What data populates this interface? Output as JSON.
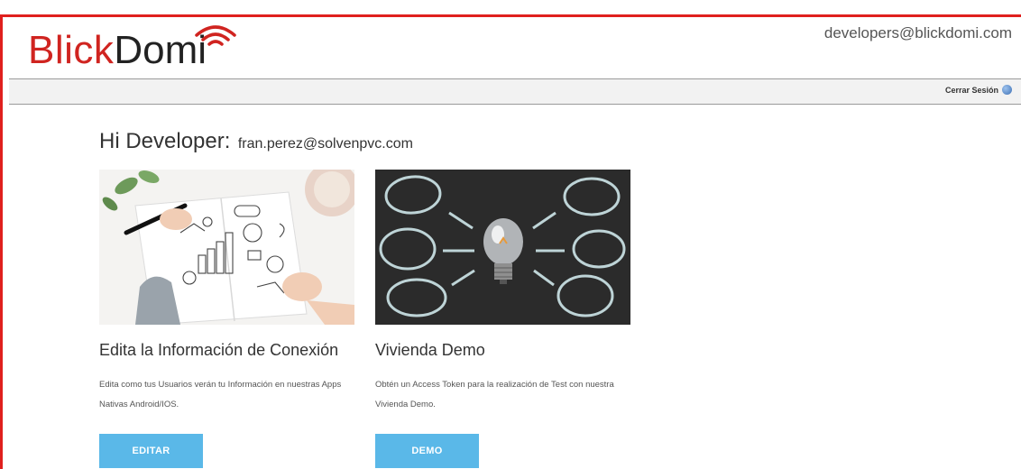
{
  "brand": {
    "logo_primary": "Blick",
    "logo_secondary": "Domi",
    "color": "#d02420"
  },
  "header": {
    "user_email": "developers@blickdomi.com"
  },
  "navbar": {
    "logout_label": "Cerrar Sesión"
  },
  "greeting": {
    "title": "Hi Developer:",
    "email": "fran.perez@solvenpvc.com"
  },
  "cards": [
    {
      "title": "Edita la Información de Conexión",
      "description": "Edita como tus Usuarios verán tu Información en nuestras Apps Nativas Android/IOS.",
      "button_label": "EDITAR",
      "image": "notebook-sketch-image"
    },
    {
      "title": "Vivienda Demo",
      "description": "Obtén un Access Token para la realización de Test con nuestra Vivienda Demo.",
      "button_label": "DEMO",
      "image": "lightbulb-chalkboard-image"
    }
  ],
  "colors": {
    "accent_button": "#5ab8e8",
    "frame": "#e0201e"
  }
}
